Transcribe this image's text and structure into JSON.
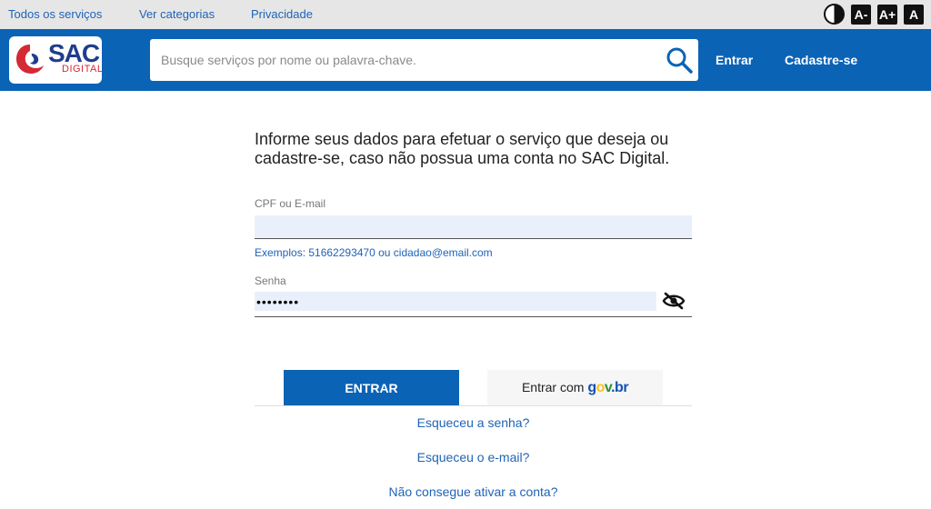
{
  "topbar": {
    "links": [
      "Todos os serviços",
      "Ver categorias",
      "Privacidade"
    ],
    "font_controls": [
      "A-",
      "A+",
      "A"
    ]
  },
  "header": {
    "logo_text": "SAC",
    "logo_subtext": "DIGITAL",
    "search_placeholder": "Busque serviços por nome ou palavra-chave.",
    "login_link": "Entrar",
    "signup_link": "Cadastre-se",
    "brand_color": "#0b63b6"
  },
  "form": {
    "heading": "Informe seus dados para efetuar o serviço que deseja ou cadastre-se, caso não possua uma conta no SAC Digital.",
    "cpf_label": "CPF ou E-mail",
    "cpf_value": "",
    "hint": "Exemplos: 51662293470 ou cidadao@email.com",
    "password_label": "Senha",
    "password_value": "••••••••",
    "enter_button": "ENTRAR",
    "gov_button_prefix": "Entrar com",
    "gov_logo": {
      "p1": "g",
      "p2": "o",
      "p3": "v",
      "p4": ".br"
    },
    "forgot_password": "Esqueceu a senha?",
    "forgot_email": "Esqueceu o e-mail?",
    "cannot_activate": "Não consegue ativar a conta?"
  }
}
